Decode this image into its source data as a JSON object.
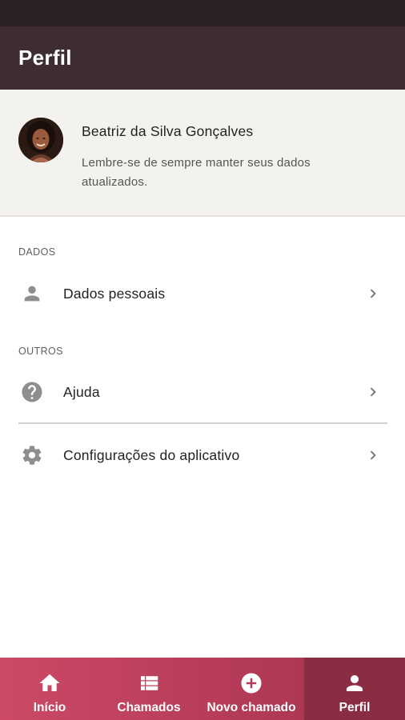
{
  "app_bar": {
    "title": "Perfil"
  },
  "profile": {
    "name": "Beatriz da Silva Gonçalves",
    "message": "Lembre-se de sempre manter seus dados atualizados."
  },
  "sections": {
    "dados": {
      "label": "DADOS",
      "items": [
        {
          "label": "Dados pessoais",
          "icon": "person-icon"
        }
      ]
    },
    "outros": {
      "label": "OUTROS",
      "items": [
        {
          "label": "Ajuda",
          "icon": "help-icon"
        },
        {
          "label": "Configurações do aplicativo",
          "icon": "gear-icon"
        }
      ]
    }
  },
  "bottom_nav": {
    "items": [
      {
        "label": "Início",
        "icon": "home-icon"
      },
      {
        "label": "Chamados",
        "icon": "list-icon"
      },
      {
        "label": "Novo chamado",
        "icon": "add-circle-icon"
      },
      {
        "label": "Perfil",
        "icon": "person-icon",
        "active": true
      }
    ]
  },
  "colors": {
    "app_bar": "#3e2d30",
    "status_bar": "#2c2123",
    "profile_card_bg": "#f4f2ef",
    "bottom_nav_start": "#cc4a66",
    "bottom_nav_end": "#a3344f",
    "bottom_nav_active": "#8a2c42",
    "icon_gray": "#8e8e8e"
  }
}
